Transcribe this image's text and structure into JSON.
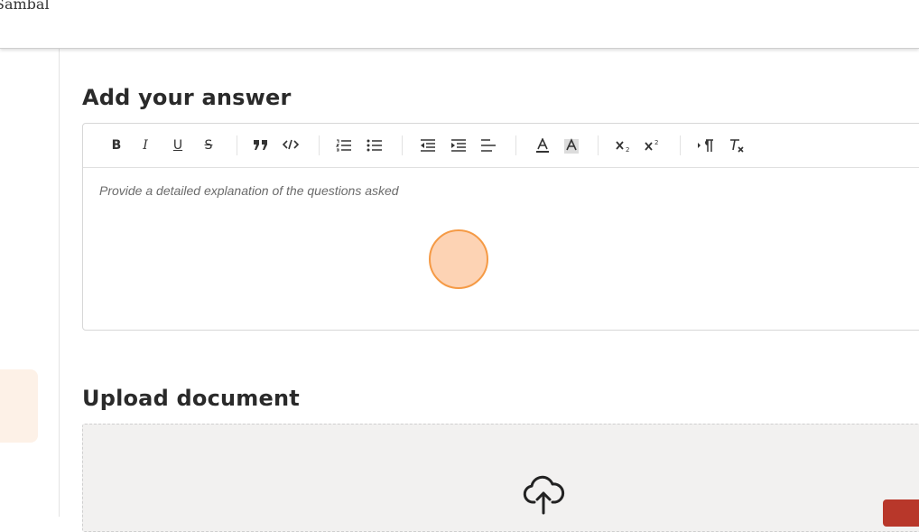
{
  "header": {
    "brand": "Sambal"
  },
  "answer_section": {
    "title": "Add your answer",
    "placeholder": "Provide a detailed explanation of the questions asked",
    "toolbar": {
      "bold": "B",
      "italic": "I",
      "underline": "U",
      "strike": "S",
      "items": [
        "bold",
        "italic",
        "underline",
        "strikethrough",
        "blockquote",
        "code",
        "ordered-list",
        "bullet-list",
        "outdent",
        "indent",
        "align",
        "font-color",
        "background-color",
        "subscript",
        "superscript",
        "text-direction",
        "clear-formatting"
      ]
    }
  },
  "upload_section": {
    "title": "Upload document"
  },
  "colors": {
    "accent": "#f59a45",
    "cursor_fill": "#fdd3b4",
    "danger": "#b8372a",
    "side_card": "#fdf1e7"
  }
}
